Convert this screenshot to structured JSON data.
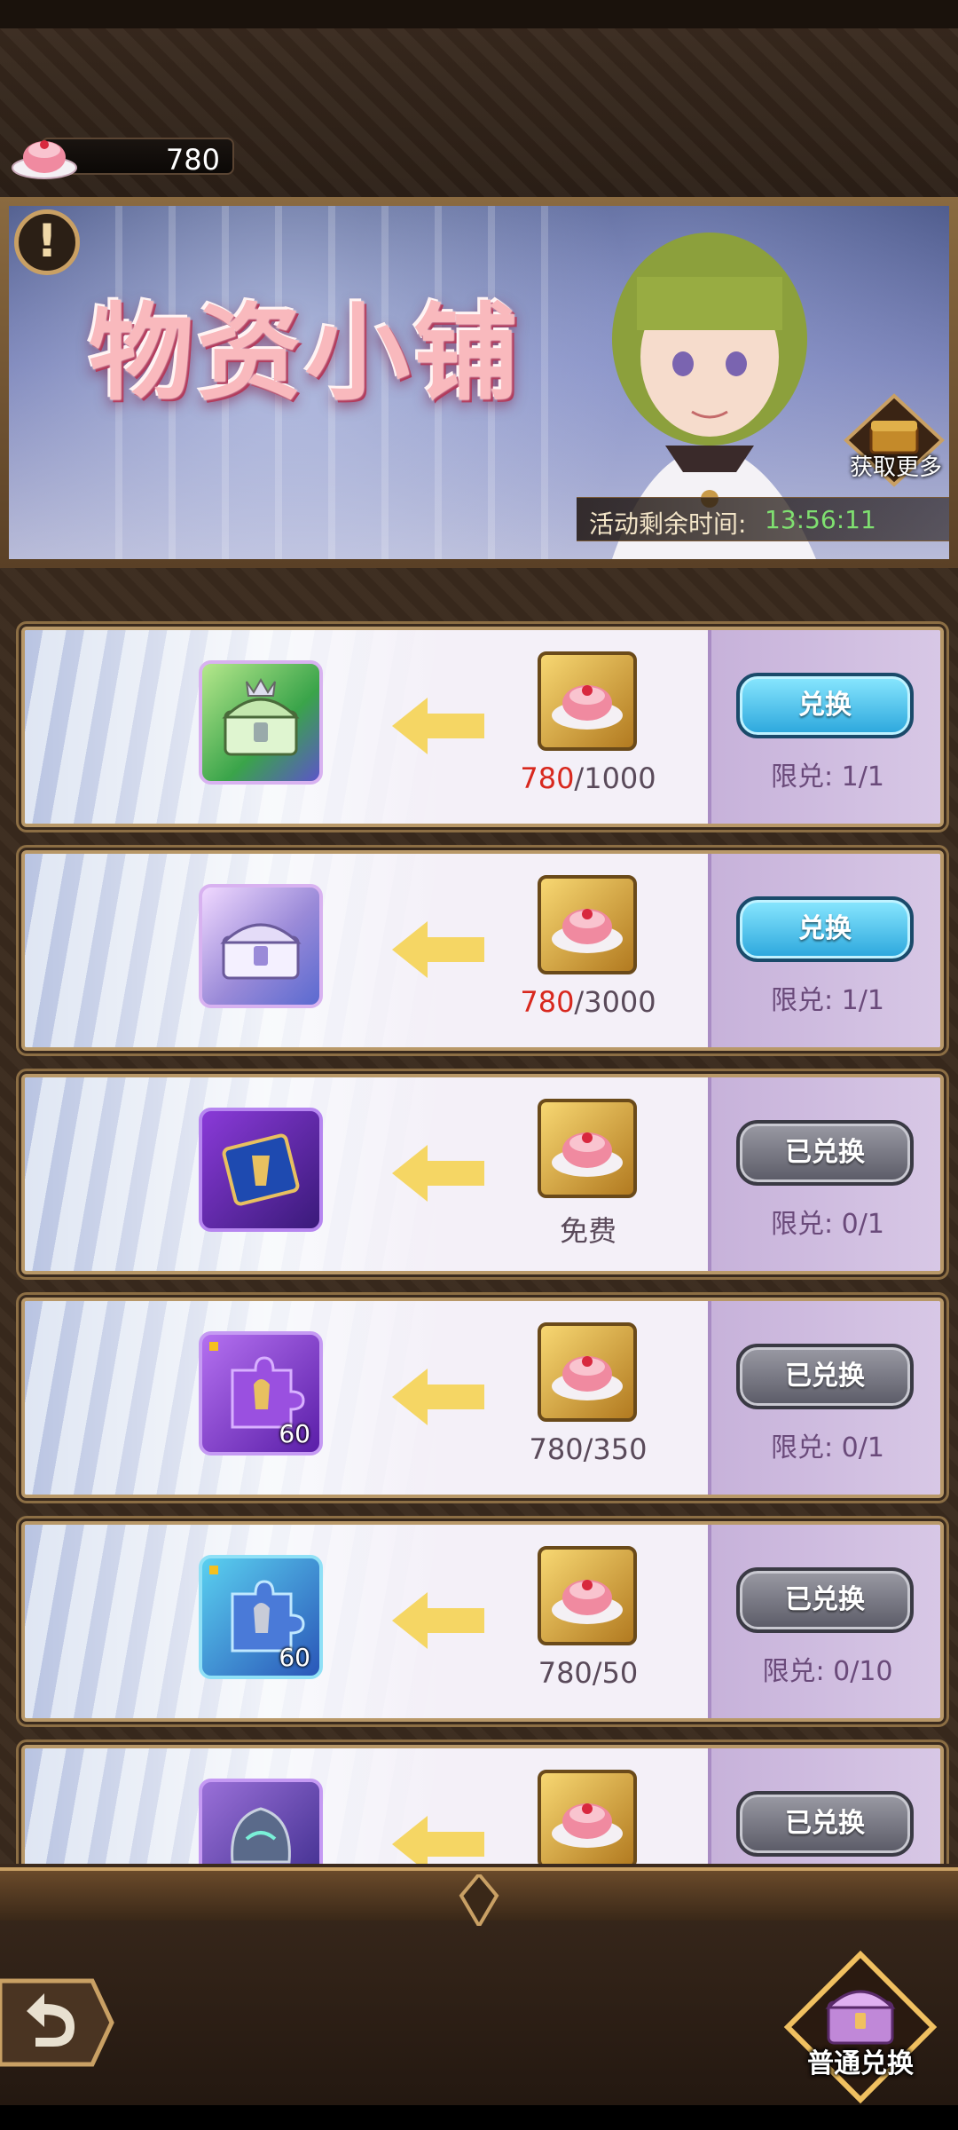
{
  "currency": {
    "value": "780",
    "icon": "jelly-dessert-icon"
  },
  "banner": {
    "title": "物资小铺",
    "info_icon": "!",
    "get_more_label": "获取更多",
    "timer_label": "活动剩余时间:",
    "timer_value": "13:56:11"
  },
  "shop": {
    "items": [
      {
        "icon": "green-crown-chest-icon",
        "cost_have": "780",
        "cost_need": "/1000",
        "button": "兑换",
        "button_state": "active",
        "limit": "限兑: 1/1"
      },
      {
        "icon": "silver-chest-icon",
        "cost_have": "780",
        "cost_need": "/3000",
        "button": "兑换",
        "button_state": "active",
        "limit": "限兑: 1/1"
      },
      {
        "icon": "purple-scroll-icon",
        "cost_text": "免费",
        "button": "已兑换",
        "button_state": "done",
        "limit": "限兑: 0/1"
      },
      {
        "icon": "purple-puzzle-piece-icon",
        "count": "60",
        "cost_text": "780/350",
        "button": "已兑换",
        "button_state": "done",
        "limit": "限兑: 0/1"
      },
      {
        "icon": "blue-puzzle-piece-icon",
        "count": "60",
        "cost_text": "780/50",
        "button": "已兑换",
        "button_state": "done",
        "limit": "限兑: 0/10"
      },
      {
        "icon": "helmet-icon",
        "button": "已兑换",
        "button_state": "done"
      }
    ]
  },
  "footer": {
    "back_icon": "back-arrow-icon",
    "normal_exchange_label": "普通兑换"
  },
  "colors": {
    "cost_have": "#d8281e",
    "timer": "#7fe070",
    "active_button": "#2aa6dc",
    "done_button": "#5a5a66"
  }
}
